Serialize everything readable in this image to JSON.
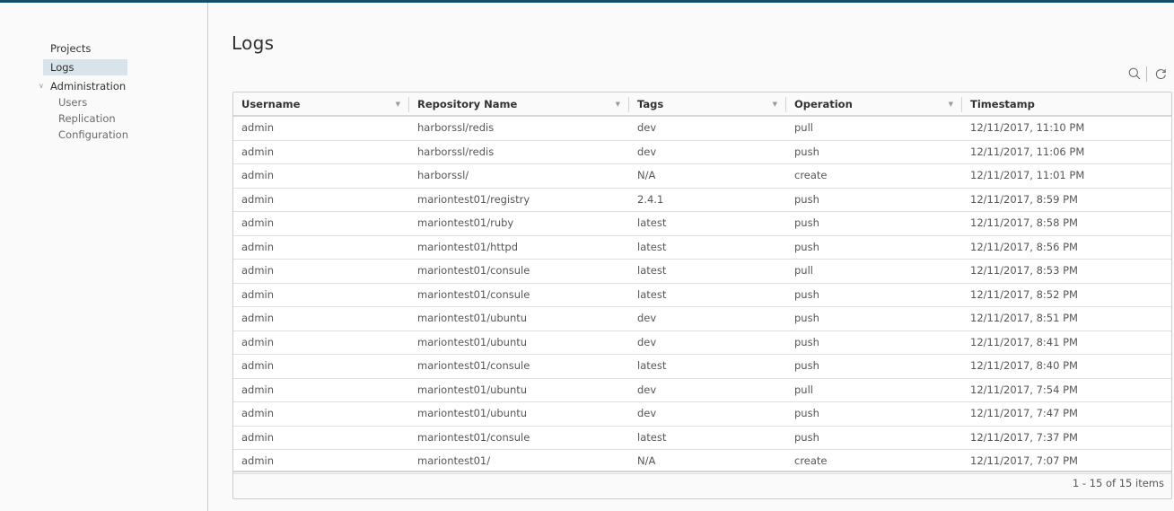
{
  "colors": {
    "topbar": "#0e4f72",
    "active_nav_bg": "#d9e4ea"
  },
  "sidebar": {
    "items": [
      {
        "label": "Projects",
        "active": false
      },
      {
        "label": "Logs",
        "active": true
      }
    ],
    "group": {
      "label": "Administration",
      "icon": "chevron-down-icon",
      "expanded": true,
      "children": [
        {
          "label": "Users"
        },
        {
          "label": "Replication"
        },
        {
          "label": "Configuration"
        }
      ]
    }
  },
  "page": {
    "title": "Logs"
  },
  "toolbar": {
    "search_icon": "search-icon",
    "refresh_icon": "refresh-icon"
  },
  "table": {
    "columns": [
      {
        "label": "Username",
        "filter": true
      },
      {
        "label": "Repository Name",
        "filter": true
      },
      {
        "label": "Tags",
        "filter": true
      },
      {
        "label": "Operation",
        "filter": true
      },
      {
        "label": "Timestamp",
        "filter": false
      }
    ],
    "rows": [
      {
        "username": "admin",
        "repository": "harborssl/redis",
        "tag": "dev",
        "operation": "pull",
        "timestamp": "12/11/2017, 11:10 PM"
      },
      {
        "username": "admin",
        "repository": "harborssl/redis",
        "tag": "dev",
        "operation": "push",
        "timestamp": "12/11/2017, 11:06 PM"
      },
      {
        "username": "admin",
        "repository": "harborssl/",
        "tag": "N/A",
        "operation": "create",
        "timestamp": "12/11/2017, 11:01 PM"
      },
      {
        "username": "admin",
        "repository": "mariontest01/registry",
        "tag": "2.4.1",
        "operation": "push",
        "timestamp": "12/11/2017, 8:59 PM"
      },
      {
        "username": "admin",
        "repository": "mariontest01/ruby",
        "tag": "latest",
        "operation": "push",
        "timestamp": "12/11/2017, 8:58 PM"
      },
      {
        "username": "admin",
        "repository": "mariontest01/httpd",
        "tag": "latest",
        "operation": "push",
        "timestamp": "12/11/2017, 8:56 PM"
      },
      {
        "username": "admin",
        "repository": "mariontest01/consule",
        "tag": "latest",
        "operation": "pull",
        "timestamp": "12/11/2017, 8:53 PM"
      },
      {
        "username": "admin",
        "repository": "mariontest01/consule",
        "tag": "latest",
        "operation": "push",
        "timestamp": "12/11/2017, 8:52 PM"
      },
      {
        "username": "admin",
        "repository": "mariontest01/ubuntu",
        "tag": "dev",
        "operation": "push",
        "timestamp": "12/11/2017, 8:51 PM"
      },
      {
        "username": "admin",
        "repository": "mariontest01/ubuntu",
        "tag": "dev",
        "operation": "push",
        "timestamp": "12/11/2017, 8:41 PM"
      },
      {
        "username": "admin",
        "repository": "mariontest01/consule",
        "tag": "latest",
        "operation": "push",
        "timestamp": "12/11/2017, 8:40 PM"
      },
      {
        "username": "admin",
        "repository": "mariontest01/ubuntu",
        "tag": "dev",
        "operation": "pull",
        "timestamp": "12/11/2017, 7:54 PM"
      },
      {
        "username": "admin",
        "repository": "mariontest01/ubuntu",
        "tag": "dev",
        "operation": "push",
        "timestamp": "12/11/2017, 7:47 PM"
      },
      {
        "username": "admin",
        "repository": "mariontest01/consule",
        "tag": "latest",
        "operation": "push",
        "timestamp": "12/11/2017, 7:37 PM"
      },
      {
        "username": "admin",
        "repository": "mariontest01/",
        "tag": "N/A",
        "operation": "create",
        "timestamp": "12/11/2017, 7:07 PM"
      }
    ],
    "footer": "1 - 15 of 15 items"
  }
}
